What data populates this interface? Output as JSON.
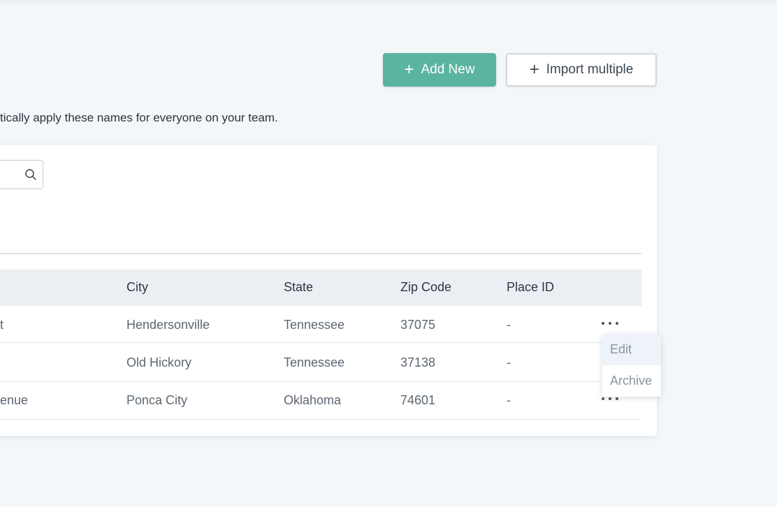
{
  "toolbar": {
    "add_label": "Add New",
    "import_label": "Import multiple",
    "plus_glyph": "+"
  },
  "subtitle": "tically apply these names for everyone on your team.",
  "search": {
    "icon": "search-icon",
    "value": ""
  },
  "table": {
    "columns": [
      "City",
      "State",
      "Zip Code",
      "Place ID"
    ],
    "rows": [
      {
        "address": "t",
        "city": "Hendersonville",
        "state": "Tennessee",
        "zip": "37075",
        "place_id": "-"
      },
      {
        "address": "",
        "city": "Old Hickory",
        "state": "Tennessee",
        "zip": "37138",
        "place_id": "-"
      },
      {
        "address": "enue",
        "city": "Ponca City",
        "state": "Oklahoma",
        "zip": "74601",
        "place_id": "-"
      }
    ]
  },
  "row_menu": {
    "items": [
      "Edit",
      "Archive"
    ]
  },
  "colors": {
    "accent": "#5bb4a0",
    "background": "#f4f7fa",
    "header_row": "#ebeff3"
  }
}
